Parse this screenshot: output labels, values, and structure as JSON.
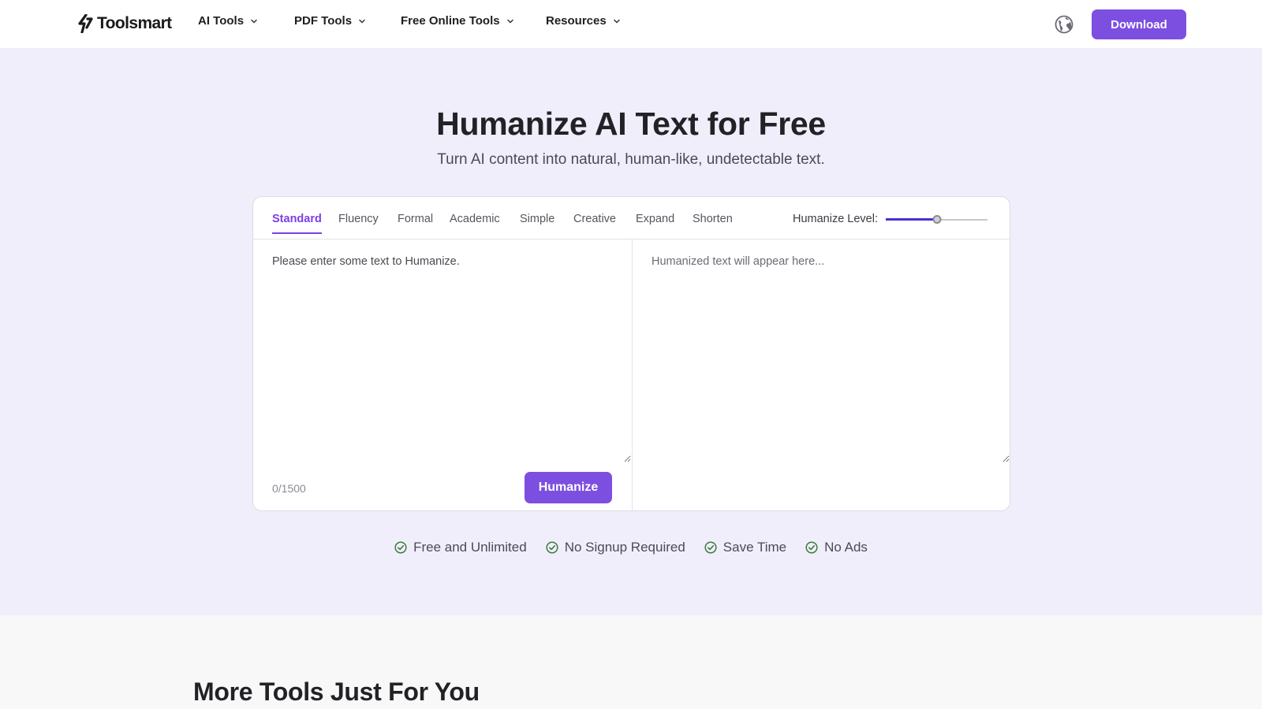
{
  "nav": {
    "logo_text": "Toolsmart",
    "items": [
      {
        "label": "AI Tools"
      },
      {
        "label": "PDF Tools"
      },
      {
        "label": "Free Online Tools"
      },
      {
        "label": "Resources"
      }
    ],
    "language_icon": "globe-icon",
    "download_label": "Download"
  },
  "hero": {
    "title": "Humanize AI Text for Free",
    "subtitle": "Turn AI content into natural, human-like, undetectable text."
  },
  "tool": {
    "modes": [
      "Standard",
      "Fluency",
      "Formal",
      "Academic",
      "Simple",
      "Creative",
      "Expand",
      "Shorten"
    ],
    "active_mode": "Standard",
    "level_label": "Humanize Level:",
    "level_value": 0.5,
    "input_placeholder": "Please enter some text to Humanize.",
    "output_placeholder": "Humanized text will appear here...",
    "counter": "0/1500",
    "humanize_label": "Humanize"
  },
  "features": [
    {
      "label": "Free and Unlimited"
    },
    {
      "label": "No Signup Required"
    },
    {
      "label": "Save Time"
    },
    {
      "label": "No Ads"
    }
  ],
  "more_tools": {
    "title": "More Tools Just For You"
  },
  "colors": {
    "accent": "#7c4fe0",
    "hero_bg": "#f1eefc",
    "check": "#3a7d3a"
  }
}
